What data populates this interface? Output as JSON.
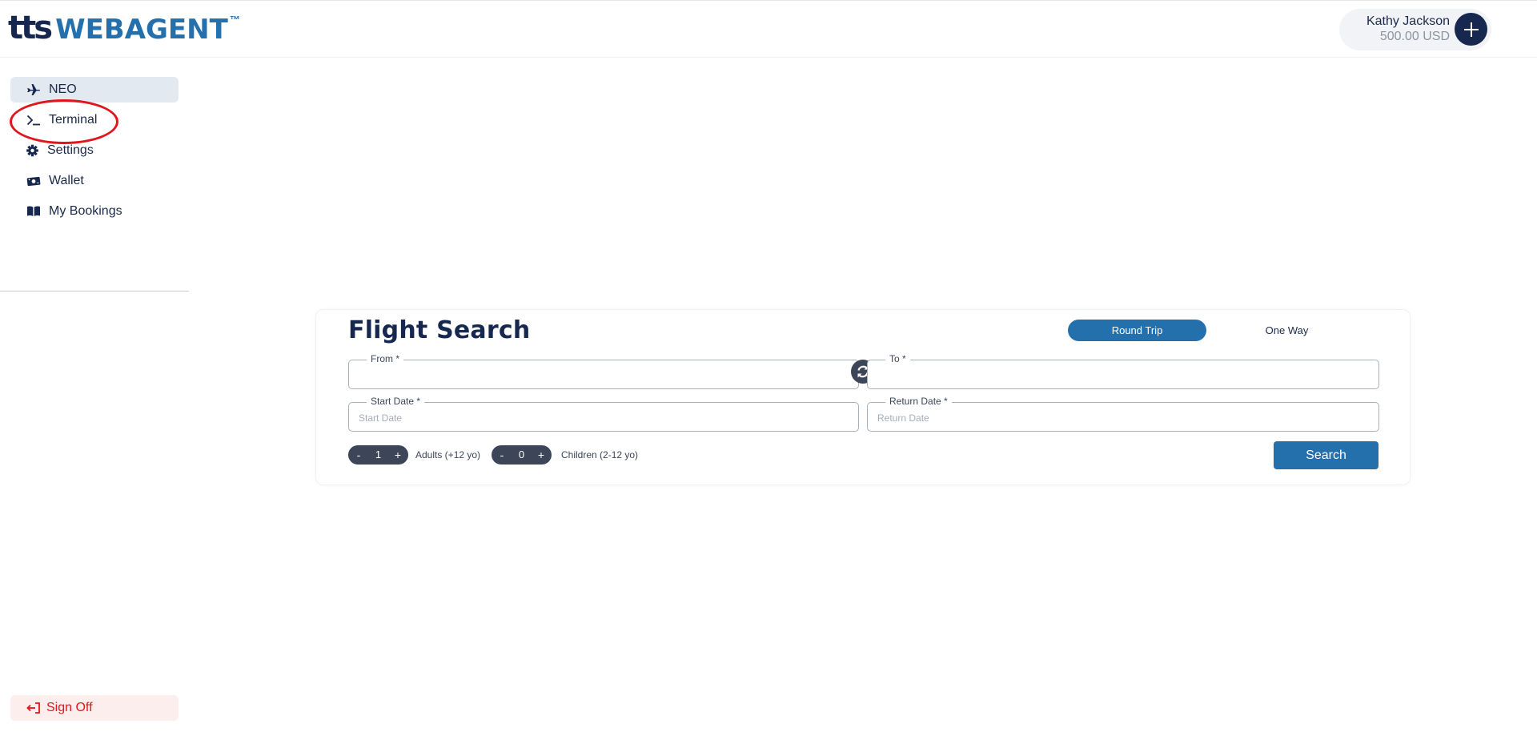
{
  "header": {
    "logo": {
      "prefix": "tts",
      "name": "WEBAGENT",
      "tm": "™"
    },
    "user": {
      "name": "Kathy Jackson",
      "balance": "500.00 USD"
    },
    "add_icon": "plus-icon"
  },
  "sidebar": {
    "items": [
      {
        "label": "NEO",
        "icon": "airplane-icon",
        "active": true
      },
      {
        "label": "Terminal",
        "icon": "terminal-icon",
        "active": false
      },
      {
        "label": "Settings",
        "icon": "gear-icon",
        "active": false
      },
      {
        "label": "Wallet",
        "icon": "wallet-icon",
        "active": false
      },
      {
        "label": "My Bookings",
        "icon": "book-icon",
        "active": false
      }
    ],
    "sign_off": {
      "label": "Sign Off",
      "icon": "sign-out-icon"
    }
  },
  "flight_search": {
    "title": "Flight Search",
    "trip_types": [
      {
        "label": "Round Trip",
        "selected": true
      },
      {
        "label": "One Way",
        "selected": false
      }
    ],
    "from": {
      "label": "From *",
      "value": "",
      "placeholder": ""
    },
    "to": {
      "label": "To *",
      "value": "",
      "placeholder": ""
    },
    "start_date": {
      "label": "Start Date *",
      "value": "",
      "placeholder": "Start Date"
    },
    "return_date": {
      "label": "Return Date *",
      "value": "",
      "placeholder": "Return Date"
    },
    "adults": {
      "minus": "-",
      "plus": "+",
      "value": "1",
      "label": "Adults (+12 yo)"
    },
    "children": {
      "minus": "-",
      "plus": "+",
      "value": "0",
      "label": "Children (2-12 yo)"
    },
    "search_label": "Search",
    "swap_icon": "swap-icon"
  },
  "colors": {
    "navy": "#16284f",
    "brand_blue": "#2470ad",
    "slate": "#3c4658",
    "active_nav_bg": "#e2e9f0",
    "sign_off_red": "#e0161c",
    "annotation_red": "#e0161c"
  }
}
